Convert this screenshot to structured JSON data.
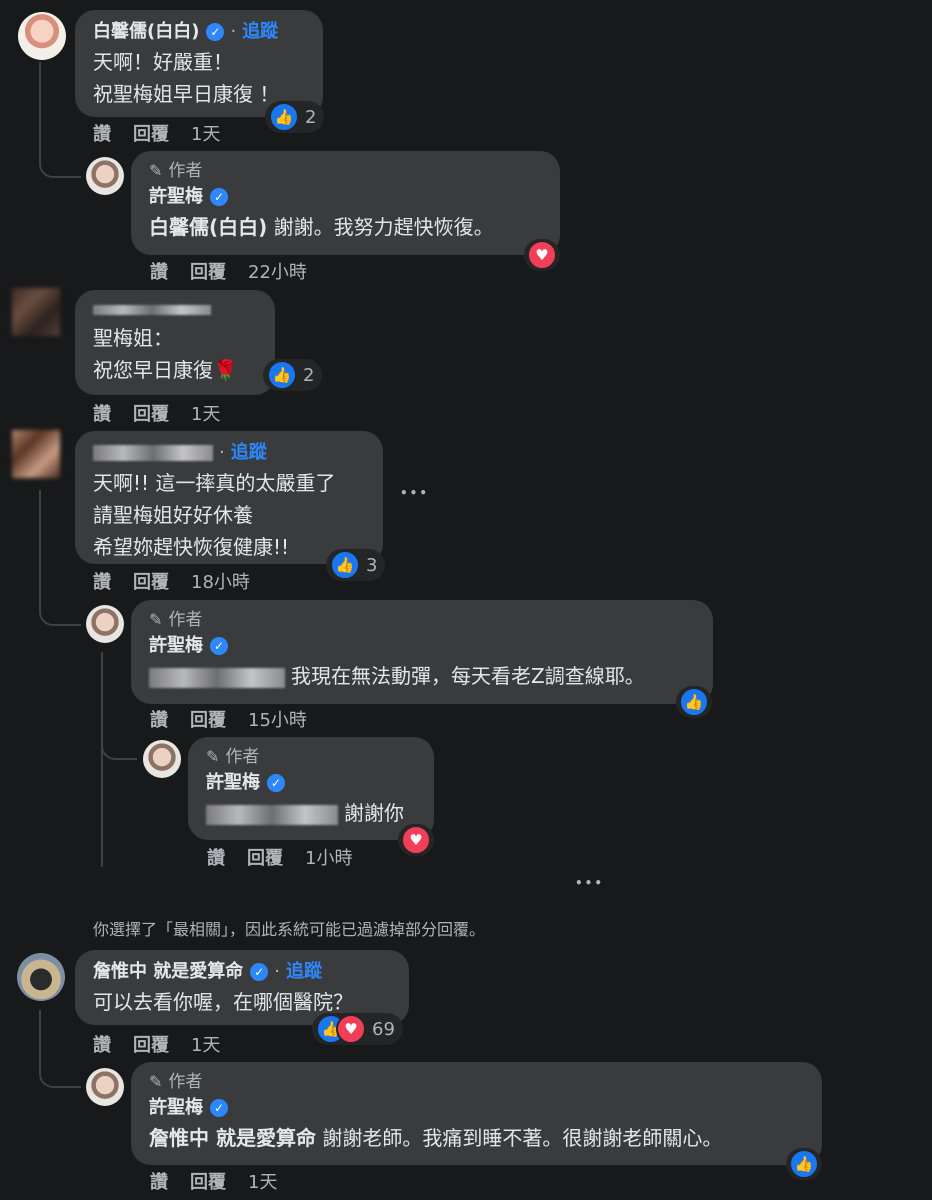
{
  "labels": {
    "like": "讚",
    "reply": "回覆",
    "follow": "追蹤",
    "author": "作者",
    "dot": "·",
    "more": "•••"
  },
  "comments": [
    {
      "name": "白馨儒(白白)",
      "verified": true,
      "text": "天啊！好嚴重！\n祝聖梅姐早日康復 ！",
      "time": "1天",
      "reaction_count": "2"
    },
    {
      "name": "許聖梅",
      "verified": true,
      "tag": "白馨儒(白白)",
      "text": " 謝謝。我努力趕快恢復。",
      "time": "22小時"
    },
    {
      "text": "聖梅姐：\n祝您早日康復🌹",
      "time": "1天",
      "reaction_count": "2"
    },
    {
      "text": "天啊!! 這一摔真的太嚴重了\n請聖梅姐好好休養\n希望妳趕快恢復健康!!",
      "time": "18小時",
      "reaction_count": "3"
    },
    {
      "name": "許聖梅",
      "verified": true,
      "text": "我現在無法動彈，每天看老Z調查線耶。",
      "time": "15小時"
    },
    {
      "name": "許聖梅",
      "verified": true,
      "text": "謝謝你",
      "time": "1小時"
    },
    {
      "name": "詹惟中 就是愛算命",
      "verified": true,
      "text": "可以去看你喔，在哪個醫院？",
      "time": "1天",
      "reaction_count": "69"
    },
    {
      "name": "許聖梅",
      "verified": true,
      "tag": "詹惟中 就是愛算命",
      "text": " 謝謝老師。我痛到睡不著。很謝謝老師關心。",
      "time": "1天"
    }
  ],
  "notice": "你選擇了「最相關」，因此系統可能已過濾掉部分回覆。",
  "icons": {
    "like": "thumbs-up-icon",
    "love": "heart-icon",
    "verified": "verified-badge-icon",
    "author": "pencil-icon"
  },
  "colors": {
    "background": "#18191a",
    "bubble": "#3a3b3c",
    "link": "#2d88ff",
    "like": "#1877f2",
    "love": "#f33e58"
  }
}
